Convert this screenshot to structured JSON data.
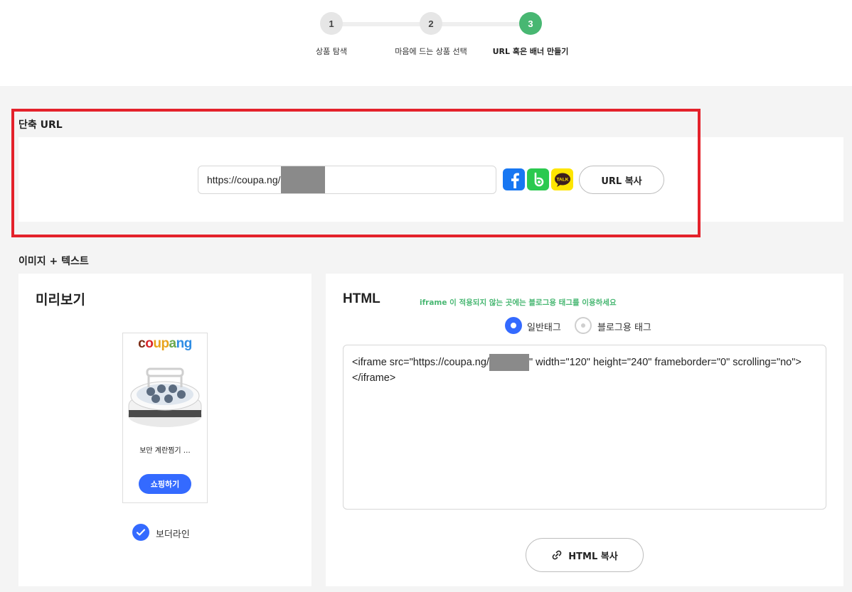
{
  "stepper": {
    "steps": [
      {
        "number": "1",
        "label": "상품 탐색"
      },
      {
        "number": "2",
        "label": "마음에 드는 상품 선택"
      },
      {
        "number": "3",
        "label": "URL 혹은 배너 만들기"
      }
    ],
    "active_color": "#48b772"
  },
  "short_url": {
    "title": "단축 URL",
    "url_prefix": "https://coupa.ng/",
    "social_icons": [
      "facebook-icon",
      "band-icon",
      "kakaotalk-icon"
    ],
    "copy_label": "URL 복사"
  },
  "image_text": {
    "title": "이미지 + 텍스트",
    "preview": {
      "heading": "미리보기",
      "banner_logo": "coupang",
      "product_name": "보만 계란찜기 …",
      "shop_label": "쇼핑하기",
      "border_label": "보더라인",
      "border_checked": true
    },
    "html": {
      "heading": "HTML",
      "note": "iframe 이 적용되지 않는 곳에는 블로그용 태그를 이용하세요",
      "options": [
        {
          "label": "일반태그",
          "selected": true
        },
        {
          "label": "블로그용 태그",
          "selected": false
        }
      ],
      "code_prefix": "<iframe src=\"https://coupa.ng/",
      "code_suffix": "\" width=\"120\" height=\"240\" frameborder=\"0\" scrolling=\"no\"></iframe>",
      "copy_label": "HTML 복사"
    }
  },
  "colors": {
    "accent_blue": "#346aff",
    "highlight_red": "#e4222b",
    "facebook": "#1877f2",
    "band": "#2bc94f",
    "kakao": "#fee500"
  }
}
